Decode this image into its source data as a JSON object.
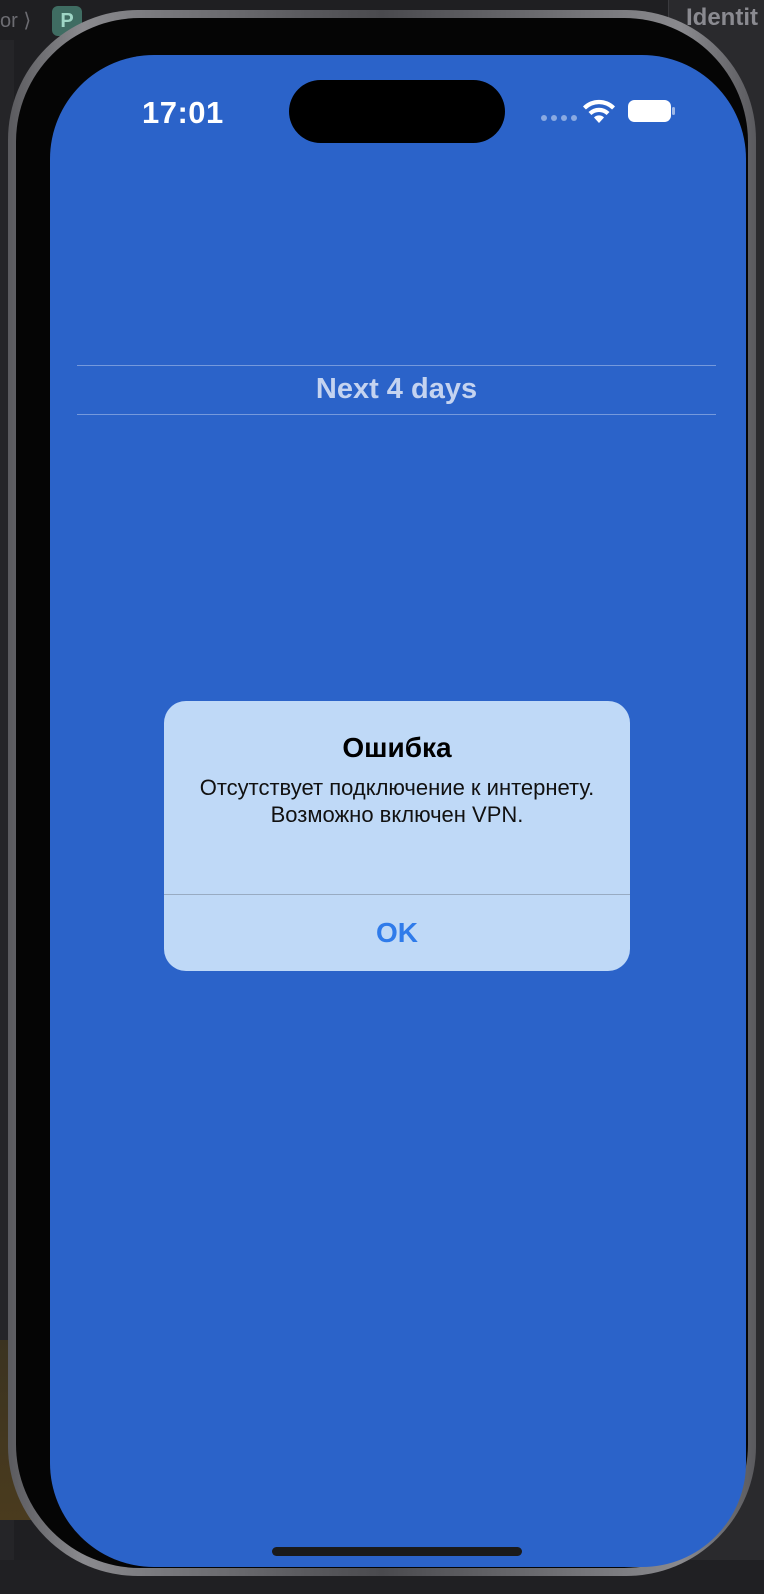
{
  "ide": {
    "inspector_title": "Identit",
    "breadcrumb_text": "or ⟩",
    "badge_letter": "P"
  },
  "status_bar": {
    "time": "17:01",
    "wifi_icon": "wifi-icon",
    "battery_icon": "battery-icon"
  },
  "main": {
    "section_header": "Next 4 days",
    "background_color": "#2b63c9"
  },
  "alert": {
    "title": "Ошибка",
    "message": "Отсутствует подключение к интернету. Возможно включен VPN.",
    "ok_label": "OK",
    "accent_color": "#2f7bea"
  }
}
